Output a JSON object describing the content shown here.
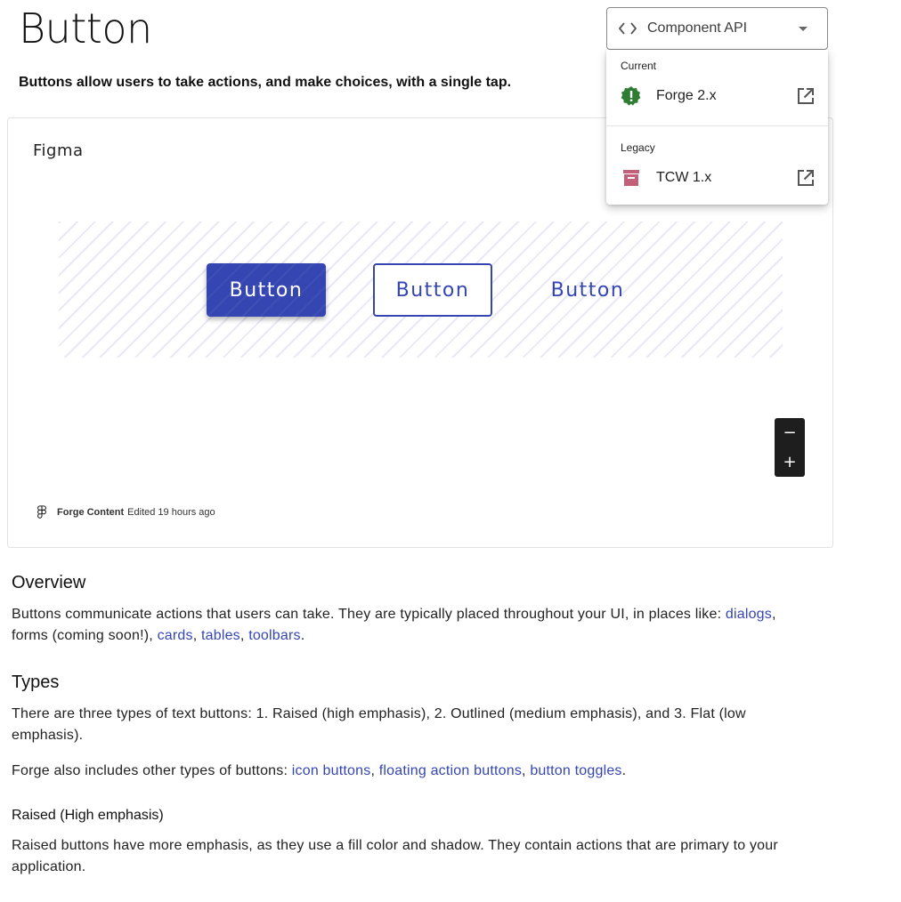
{
  "page": {
    "title": "Button",
    "subtitle": "Buttons allow users to take actions, and make choices, with a single tap."
  },
  "api_select": {
    "label": "Component API",
    "icon": "code-icon"
  },
  "api_menu": {
    "groups": [
      {
        "label": "Current",
        "item": {
          "label": "Forge 2.x",
          "icon": "badge-alert-icon",
          "icon_color": "#2e7d32"
        }
      },
      {
        "label": "Legacy",
        "item": {
          "label": "TCW 1.x",
          "icon": "archive-icon",
          "icon_color": "#c2607a"
        }
      }
    ],
    "external_icon": "open-in-new-icon"
  },
  "figma": {
    "title": "Figma",
    "buttons": {
      "raised": "Button",
      "outlined": "Button",
      "flat": "Button"
    },
    "zoom": {
      "minus": "−",
      "plus": "+"
    },
    "footer": {
      "team": "Forge Content",
      "edited": "Edited 19 hours ago"
    }
  },
  "overview": {
    "heading": "Overview",
    "text_1": "Buttons communicate actions that users can take. They are typically placed throughout your UI, in places like: ",
    "link_dialogs": "dialogs",
    "sep_1": ",",
    "text_2": "forms (coming soon!), ",
    "link_cards": "cards",
    "sep_2": ", ",
    "link_tables": "tables",
    "sep_3": ", ",
    "link_toolbars": "toolbars",
    "end": "."
  },
  "types": {
    "heading": "Types",
    "text_1": "There are three types of text buttons: 1. Raised (high emphasis), 2. Outlined (medium emphasis), and 3. Flat (low emphasis).",
    "text_2": "Forge also includes other types of buttons: ",
    "link_icon_buttons": "icon buttons",
    "sep_1": ", ",
    "link_fab": "floating action buttons",
    "sep_2": ", ",
    "link_toggles": "button toggles",
    "end": "."
  },
  "raised": {
    "heading": "Raised (High emphasis)",
    "text": "Raised buttons have more emphasis, as they use a fill color and shadow. They contain actions that are primary to your application."
  },
  "colors": {
    "primary": "#3546b2"
  }
}
